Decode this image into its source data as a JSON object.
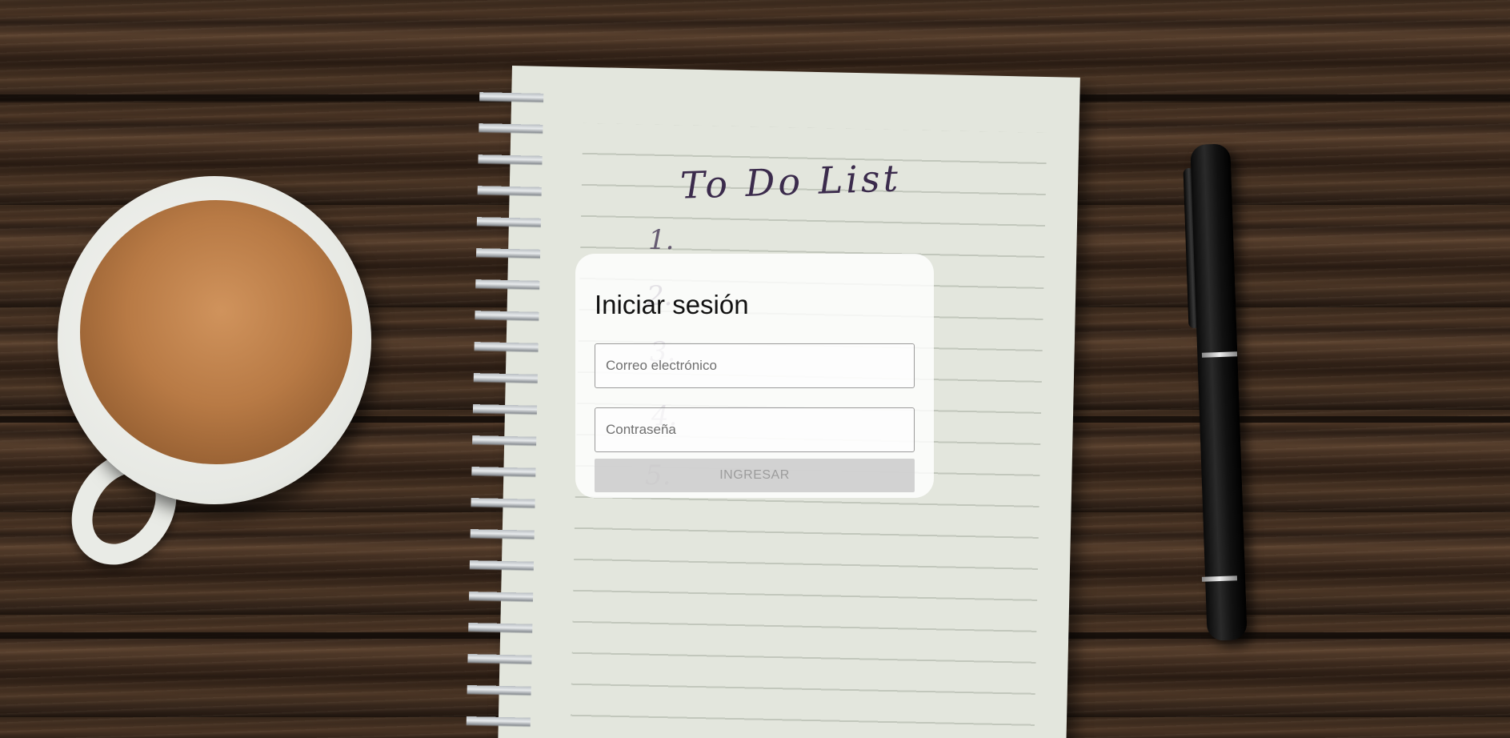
{
  "background": {
    "notebook_heading": "To Do List",
    "list_numbers": [
      "1.",
      "2.",
      "3.",
      "4.",
      "5."
    ]
  },
  "login": {
    "title": "Iniciar sesión",
    "email_placeholder": "Correo electrónico",
    "email_value": "",
    "password_placeholder": "Contraseña",
    "password_value": "",
    "submit_label": "INGRESAR",
    "submit_enabled": false
  },
  "colors": {
    "card_background": "#ffffffd1",
    "field_border": "#9a9a9a",
    "button_disabled_bg": "#c8c8c8",
    "button_disabled_text": "#9c9c9c"
  }
}
